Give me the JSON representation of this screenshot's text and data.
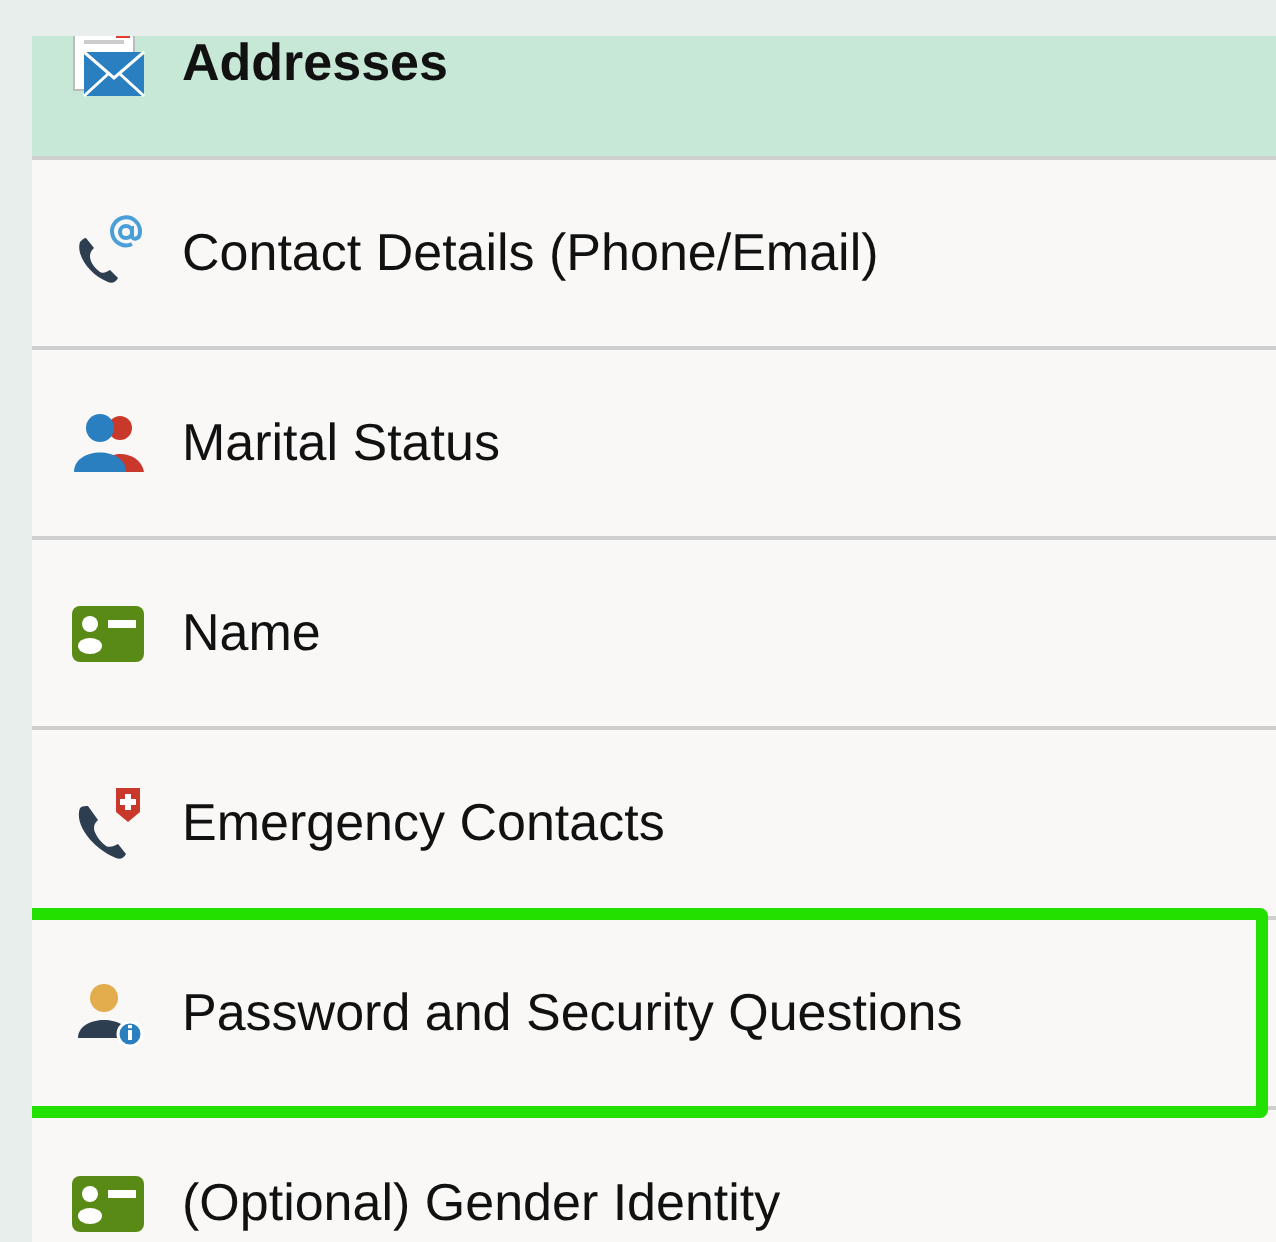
{
  "menu": [
    {
      "kind": "address",
      "label": "Addresses",
      "selected": true,
      "highlighted": false
    },
    {
      "kind": "contact",
      "label": "Contact Details (Phone/Email)",
      "selected": false,
      "highlighted": false
    },
    {
      "kind": "marital",
      "label": "Marital Status",
      "selected": false,
      "highlighted": false
    },
    {
      "kind": "name",
      "label": "Name",
      "selected": false,
      "highlighted": false
    },
    {
      "kind": "emergency",
      "label": "Emergency Contacts",
      "selected": false,
      "highlighted": false
    },
    {
      "kind": "password",
      "label": "Password and Security Questions",
      "selected": false,
      "highlighted": true
    },
    {
      "kind": "name",
      "label": "(Optional) Gender Identity",
      "selected": false,
      "highlighted": false
    }
  ]
}
